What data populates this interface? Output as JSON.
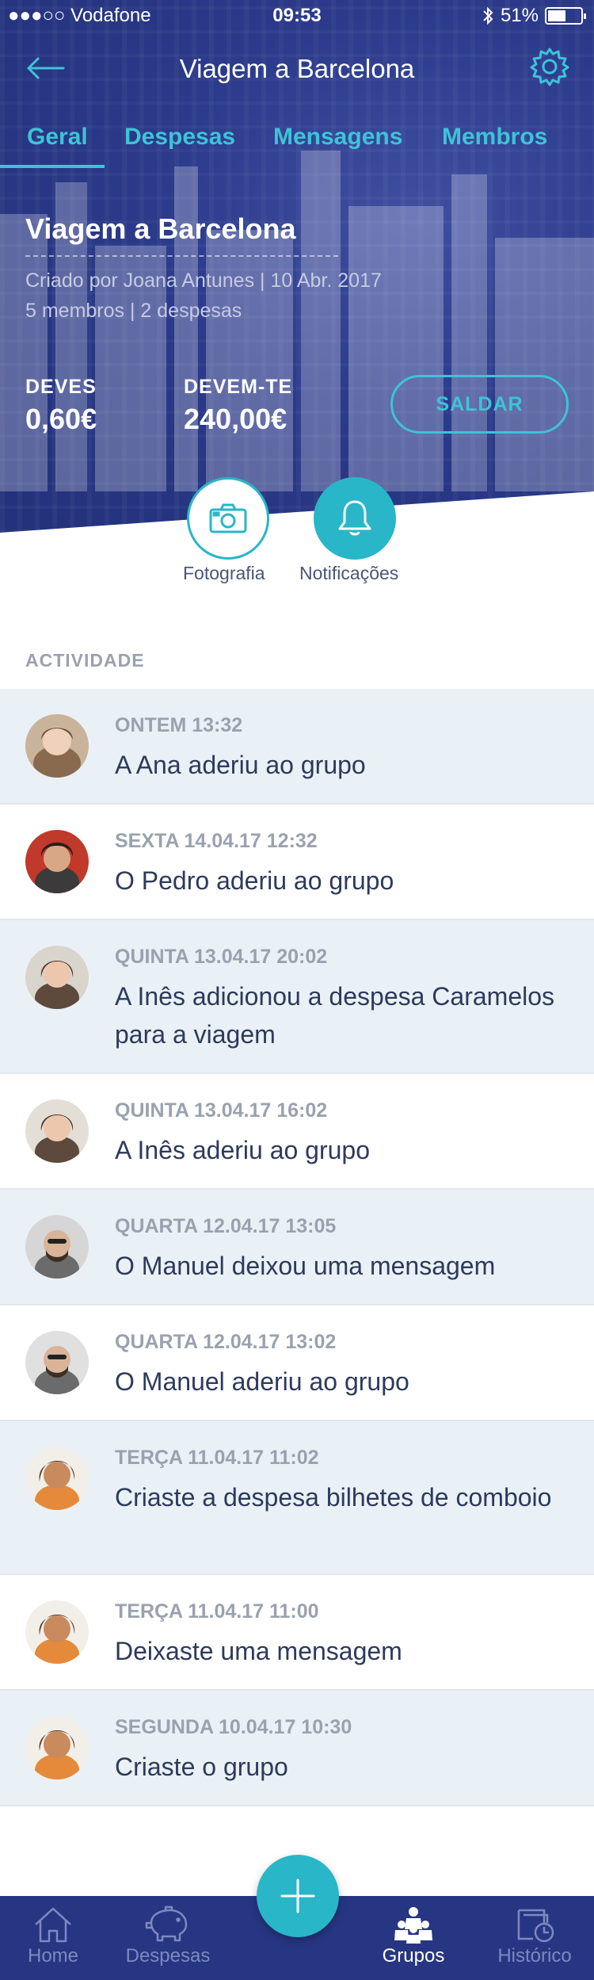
{
  "status_bar": {
    "carrier": "●●●○○ Vodafone",
    "time": "09:53",
    "battery": "51%"
  },
  "header": {
    "title": "Viagem a Barcelona"
  },
  "tabs": [
    {
      "label": "Geral",
      "active": true
    },
    {
      "label": "Despesas",
      "active": false
    },
    {
      "label": "Mensagens",
      "active": false
    },
    {
      "label": "Membros",
      "active": false
    }
  ],
  "group": {
    "name": "Viagem a Barcelona",
    "created": "Criado por Joana Antunes | 10 Abr. 2017",
    "summary": "5 membros | 2 despesas"
  },
  "balance": {
    "owe_label": "DEVES",
    "owe_value": "0,60€",
    "owed_label": "DEVEM-TE",
    "owed_value": "240,00€",
    "settle_label": "SALDAR"
  },
  "actions": {
    "photo_label": "Fotografia",
    "notifications_label": "Notificações"
  },
  "activity": {
    "section_title": "ACTIVIDADE",
    "items": [
      {
        "date": "ONTEM 13:32",
        "text": "A Ana aderiu ao grupo"
      },
      {
        "date": "SEXTA 14.04.17 12:32",
        "text": "O Pedro aderiu ao grupo"
      },
      {
        "date": "QUINTA 13.04.17 20:02",
        "text": "A Inês adicionou a despesa Caramelos para a viagem"
      },
      {
        "date": "QUINTA 13.04.17 16:02",
        "text": "A Inês aderiu ao grupo"
      },
      {
        "date": "QUARTA 12.04.17 13:05",
        "text": "O Manuel deixou uma mensagem"
      },
      {
        "date": "QUARTA 12.04.17 13:02",
        "text": "O Manuel aderiu ao grupo"
      },
      {
        "date": "TERÇA 11.04.17 11:02",
        "text": "Criaste a despesa bilhetes de comboio"
      },
      {
        "date": "TERÇA 11.04.17 11:00",
        "text": "Deixaste uma mensagem"
      },
      {
        "date": "SEGUNDA 10.04.17 10:30",
        "text": "Criaste o grupo"
      }
    ]
  },
  "bottom_nav": [
    {
      "label": "Home",
      "icon": "home-icon"
    },
    {
      "label": "Despesas",
      "icon": "piggy-bank-icon"
    },
    {
      "label": "Grupos",
      "icon": "group-icon",
      "active": true
    },
    {
      "label": "Histórico",
      "icon": "history-icon"
    }
  ],
  "colors": {
    "primary": "#263682",
    "accent": "#29b6c8",
    "shade_row": "#eaf1f6"
  }
}
